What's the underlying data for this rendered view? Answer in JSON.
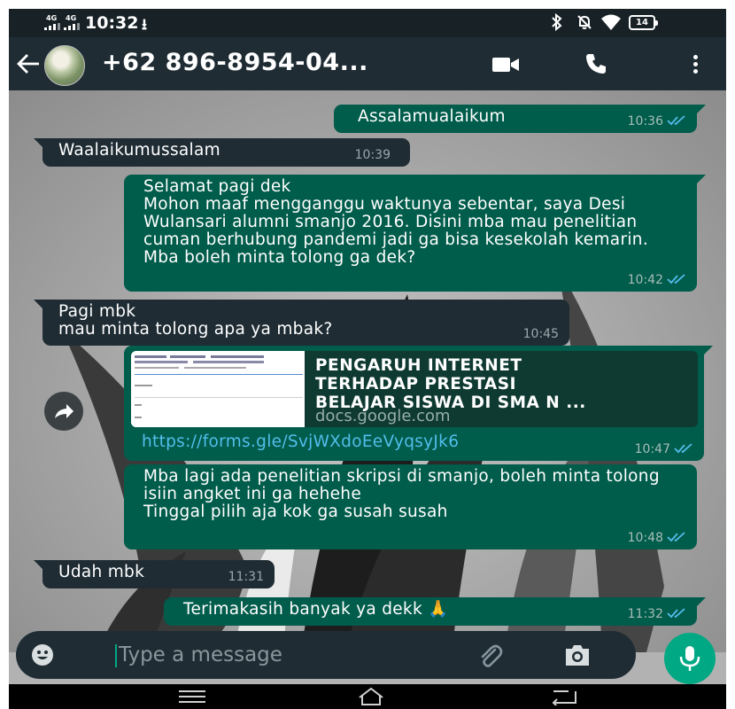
{
  "status_bar": {
    "network_1": "4G",
    "network_2": "4G",
    "time": "10:32",
    "upload_symbol": "⭳",
    "battery": "14",
    "icons": [
      "signal-icon",
      "upload-icon",
      "bluetooth-icon",
      "mute-icon",
      "wifi-icon",
      "battery-icon"
    ]
  },
  "header": {
    "contact_name": "+62 896-8954-04...",
    "icons": [
      "back-arrow-icon",
      "avatar",
      "video-call-icon",
      "voice-call-icon",
      "more-options-icon"
    ]
  },
  "messages": [
    {
      "direction": "out",
      "text": "Assalamualaikum",
      "time": "10:36",
      "status": "read"
    },
    {
      "direction": "in",
      "text": "Waalaikumussalam",
      "time": "10:39"
    },
    {
      "direction": "out",
      "text": "Selamat pagi dek\nMohon maaf mengganggu waktunya sebentar, saya Desi Wulansari alumni smanjo 2016. Disini mba mau penelitian cuman berhubung pandemi jadi ga bisa kesekolah kemarin. Mba boleh minta tolong ga dek?",
      "time": "10:42",
      "status": "read"
    },
    {
      "direction": "in",
      "text": "Pagi mbk\nmau minta tolong apa ya mbak?",
      "time": "10:45"
    },
    {
      "direction": "out",
      "type": "link",
      "preview_title": "PENGARUH INTERNET\nTERHADAP PRESTASI\nBELAJAR SISWA DI SMA N ...",
      "preview_domain": "docs.google.com",
      "url": "https://forms.gle/SvjWXdoEeVyqsyJk6",
      "time": "10:47",
      "status": "read"
    },
    {
      "direction": "out",
      "text": "Mba lagi ada penelitian skripsi di smanjo, boleh minta tolong isiin angket ini ga hehehe\nTinggal pilih aja kok ga susah susah",
      "time": "10:48",
      "status": "read"
    },
    {
      "direction": "in",
      "text": "Udah mbk",
      "time": "11:31"
    },
    {
      "direction": "out",
      "text": "Terimakasih banyak ya dekk 🙏",
      "time": "11:32",
      "status": "read"
    }
  ],
  "composer": {
    "placeholder": "Type a message",
    "icons": [
      "emoji-icon",
      "attach-icon",
      "camera-icon",
      "microphone-icon"
    ]
  },
  "colors": {
    "header": "#1f2c34",
    "incoming_bubble": "#1f2c34",
    "outgoing_bubble": "#005c4b",
    "accent": "#00a884",
    "link": "#53bdeb",
    "read_ticks": "#53bdeb"
  },
  "nav_bar": {
    "icons": [
      "nav-menu-icon",
      "nav-home-icon",
      "nav-back-icon"
    ]
  }
}
